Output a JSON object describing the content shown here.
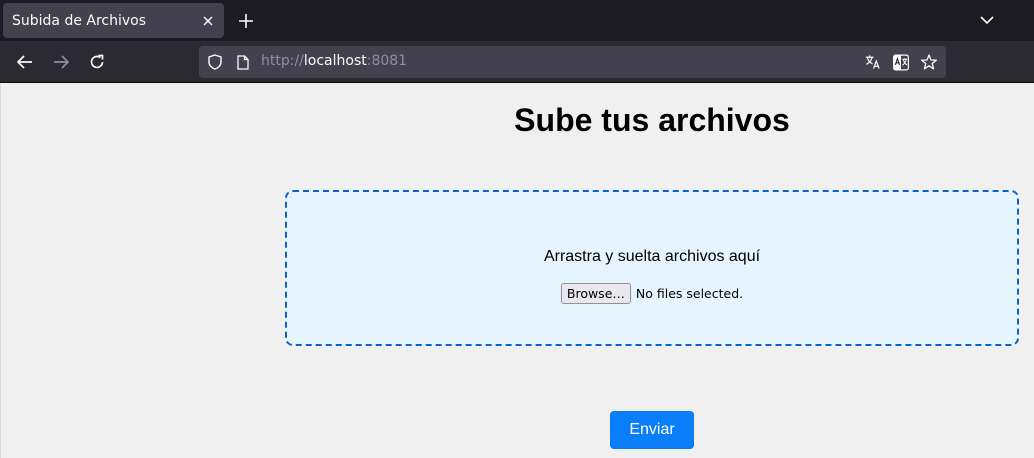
{
  "browser": {
    "tab_title": "Subida de Archivos",
    "url_scheme": "http://",
    "url_host": "localhost",
    "url_port": ":8081",
    "icons": [
      "close-icon",
      "plus-icon",
      "chevron-down-icon",
      "back-arrow-icon",
      "forward-arrow-icon",
      "reload-icon",
      "shield-icon",
      "page-icon",
      "translate-icon",
      "reader-translate-icon",
      "star-icon"
    ]
  },
  "page": {
    "heading": "Sube tus archivos",
    "dropzone_text": "Arrastra y suelta archivos aquí",
    "browse_label": "Browse…",
    "file_status": "No files selected.",
    "submit_label": "Enviar"
  },
  "colors": {
    "accent": "#0a7ef8",
    "dropzone_bg": "#e6f5fd",
    "dropzone_border": "#0a62c4",
    "page_bg": "#f0f0f0"
  }
}
